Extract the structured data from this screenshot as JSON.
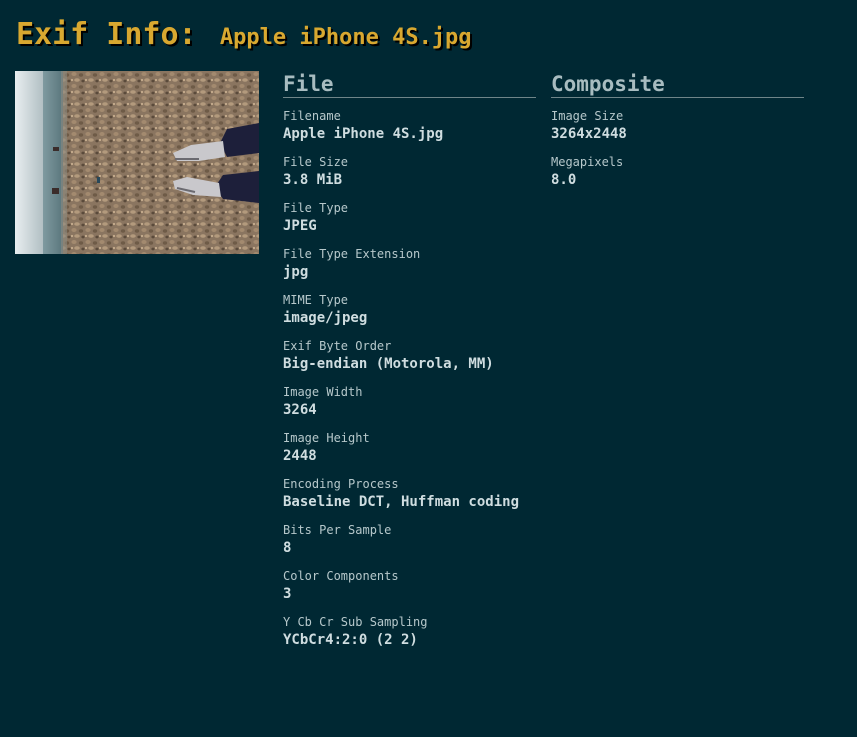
{
  "title": {
    "prefix": "Exif Info:",
    "filename": "Apple iPhone 4S.jpg"
  },
  "thumbnail": {
    "description_icon": "photo-thumbnail"
  },
  "file_section": {
    "heading": "File",
    "entries": [
      {
        "label": "Filename",
        "value": "Apple iPhone 4S.jpg"
      },
      {
        "label": "File Size",
        "value": "3.8 MiB"
      },
      {
        "label": "File Type",
        "value": "JPEG"
      },
      {
        "label": "File Type Extension",
        "value": "jpg"
      },
      {
        "label": "MIME Type",
        "value": "image/jpeg"
      },
      {
        "label": "Exif Byte Order",
        "value": "Big-endian (Motorola, MM)"
      },
      {
        "label": "Image Width",
        "value": "3264"
      },
      {
        "label": "Image Height",
        "value": "2448"
      },
      {
        "label": "Encoding Process",
        "value": "Baseline DCT, Huffman coding"
      },
      {
        "label": "Bits Per Sample",
        "value": "8"
      },
      {
        "label": "Color Components",
        "value": "3"
      },
      {
        "label": "Y Cb Cr Sub Sampling",
        "value": "YCbCr4:2:0 (2 2)"
      }
    ]
  },
  "composite_section": {
    "heading": "Composite",
    "entries": [
      {
        "label": "Image Size",
        "value": "3264x2448"
      },
      {
        "label": "Megapixels",
        "value": "8.0"
      }
    ]
  },
  "colors": {
    "background": "#002833",
    "title": "#d8a830",
    "heading": "#a8bcc0",
    "text": "#cfdde0"
  }
}
